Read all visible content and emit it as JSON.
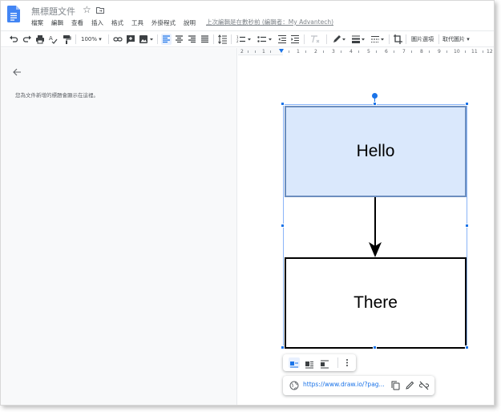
{
  "header": {
    "title": "無標題文件",
    "last_edit": "上次編輯是在數秒前 (編輯者：My Advantech)"
  },
  "menu": [
    "檔案",
    "編輯",
    "查看",
    "插入",
    "格式",
    "工具",
    "外掛程式",
    "說明"
  ],
  "toolbar": {
    "zoom": "100%",
    "image_options_label": "圖片選項",
    "replace_image_label": "取代圖片"
  },
  "ruler": {
    "numbers": [
      "2",
      "1",
      "1",
      "2",
      "3",
      "4",
      "5",
      "6",
      "7",
      "8",
      "9",
      "10",
      "11",
      "12"
    ]
  },
  "sidebar": {
    "outline_hint": "您為文件新增的標題會顯示在這裡。"
  },
  "drawing": {
    "box1_label": "Hello",
    "box2_label": "There"
  },
  "link_bar": {
    "url": "https://www.draw.io/?pag..."
  },
  "colors": {
    "accent": "#1a73e8",
    "box1_fill": "#dae8fc",
    "box1_stroke": "#6c8ebf"
  }
}
